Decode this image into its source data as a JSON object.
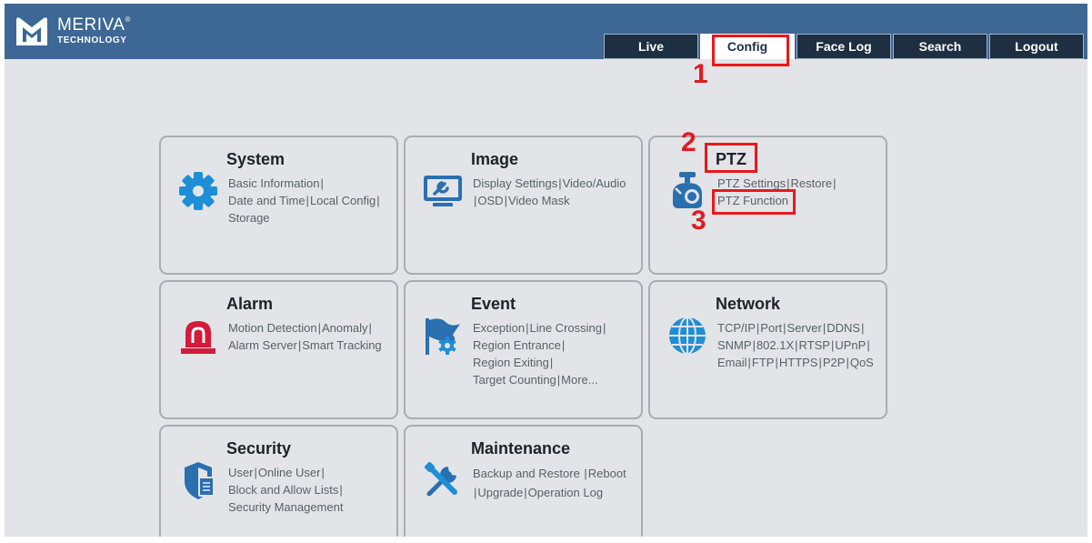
{
  "header": {
    "logo_name": "MERIVA",
    "logo_reg": "®",
    "logo_sub": "TECHNOLOGY",
    "tabs": [
      {
        "label": "Live",
        "active": false
      },
      {
        "label": "Config",
        "active": true
      },
      {
        "label": "Face Log",
        "active": false
      },
      {
        "label": "Search",
        "active": false
      },
      {
        "label": "Logout",
        "active": false
      }
    ]
  },
  "cards": {
    "system": {
      "title": "System",
      "icon": "gear-icon",
      "links": [
        "Basic Information",
        "Date and Time",
        "Local Config",
        "Storage"
      ]
    },
    "image": {
      "title": "Image",
      "icon": "monitor-wrench-icon",
      "links": [
        "Display Settings",
        "Video/Audio",
        "OSD",
        "Video Mask"
      ]
    },
    "ptz": {
      "title": "PTZ",
      "icon": "ptz-camera-icon",
      "links": [
        "PTZ Settings",
        "Restore",
        "PTZ Function"
      ]
    },
    "alarm": {
      "title": "Alarm",
      "icon": "alarm-siren-icon",
      "links": [
        "Motion Detection",
        "Anomaly",
        "Alarm Server",
        "Smart Tracking"
      ]
    },
    "event": {
      "title": "Event",
      "icon": "flag-gear-icon",
      "links": [
        "Exception",
        "Line Crossing",
        "Region Entrance",
        "Region Exiting",
        "Target Counting",
        "More..."
      ]
    },
    "network": {
      "title": "Network",
      "icon": "globe-icon",
      "links": [
        "TCP/IP",
        "Port",
        "Server",
        "DDNS",
        "SNMP",
        "802.1X",
        "RTSP",
        "UPnP",
        "Email",
        "FTP",
        "HTTPS",
        "P2P",
        "QoS"
      ]
    },
    "security": {
      "title": "Security",
      "icon": "shield-document-icon",
      "links": [
        "User",
        "Online User",
        "Block and Allow Lists",
        "Security Management"
      ]
    },
    "maintenance": {
      "title": "Maintenance",
      "icon": "tools-icon",
      "links": [
        "Backup and Restore",
        "Reboot",
        "Upgrade",
        "Operation Log"
      ]
    }
  },
  "annotations": [
    "1",
    "2",
    "3"
  ],
  "colors": {
    "header": "#3d6794",
    "tab_dark": "#1f2f42",
    "icon_blue": "#1e8fd6",
    "alarm_red": "#d51a3a",
    "highlight": "#e8181e"
  }
}
